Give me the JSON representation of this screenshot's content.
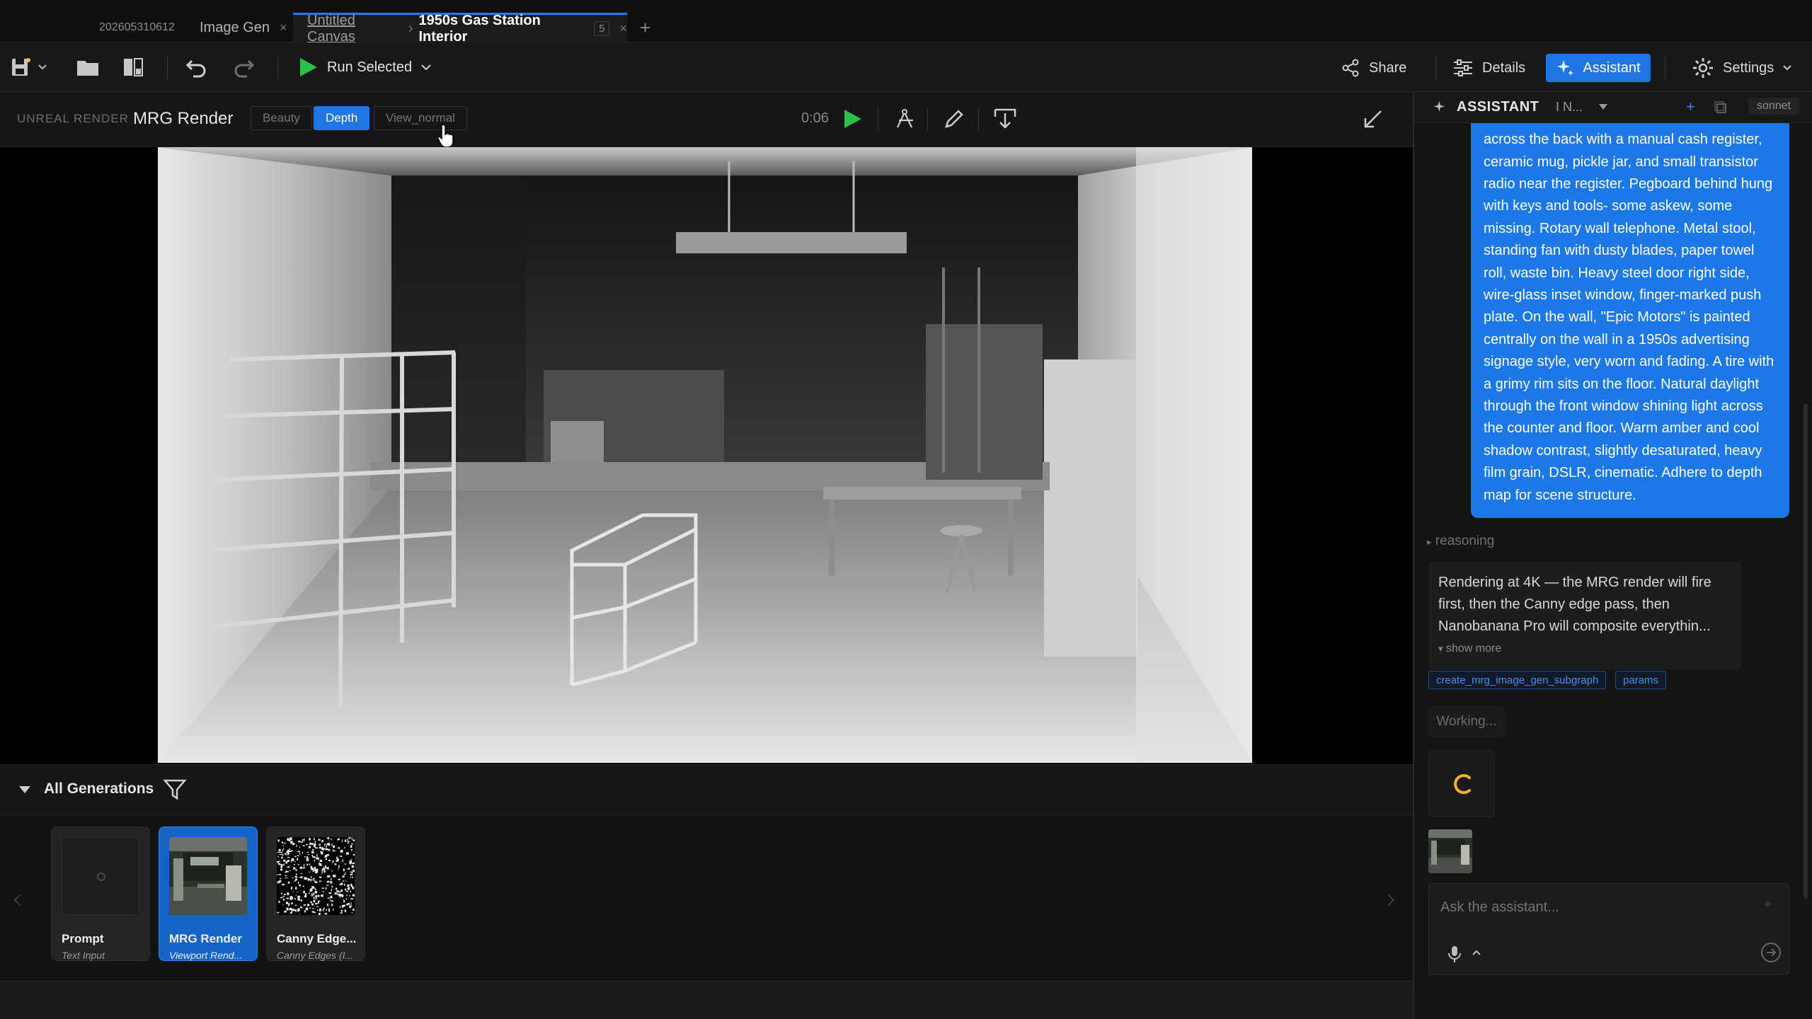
{
  "tabs": {
    "date_tab": "202605310612",
    "image_gen": "Image Gen",
    "canvas_crumb": "Untitled Canvas",
    "canvas_separator": "›",
    "canvas_title": "1950s Gas Station Interior",
    "canvas_count": "5",
    "close_glyph": "×",
    "add_glyph": "+"
  },
  "toolbar": {
    "run_selected": "Run Selected",
    "share": "Share",
    "details": "Details",
    "assistant": "Assistant",
    "settings": "Settings",
    "run_color": "#27c24c",
    "accent_color": "#1f76e3"
  },
  "render": {
    "source_label": "UNREAL RENDER",
    "title": "MRG Render",
    "passes": [
      "Beauty",
      "Depth",
      "View_normal"
    ],
    "active_pass": "Depth",
    "elapsed": "0:06"
  },
  "generations": {
    "title": "All Generations",
    "items": [
      {
        "name": "Prompt",
        "type": "Text Input"
      },
      {
        "name": "MRG Render",
        "type": "Viewport Rend..."
      },
      {
        "name": "Canny Edge...",
        "type": "Canny Edges (I..."
      }
    ],
    "selected": "MRG Render"
  },
  "assistant": {
    "title": "ASSISTANT",
    "session": "I N...",
    "model": "sonnet",
    "user_message": "across the back with a manual cash register, ceramic mug, pickle jar, and small transistor radio near the register. Pegboard behind hung with keys and tools- some askew, some missing. Rotary wall telephone. Metal stool, standing fan with dusty blades, paper towel roll, waste bin. Heavy steel door right side, wire-glass inset window, finger-marked push plate. On the wall, \"Epic Motors\" is painted centrally on the wall in a 1950s advertising signage style, very worn and fading. A tire with a grimy rim sits on the floor. Natural daylight through the front window shining light across the counter and floor. Warm amber and cool shadow contrast, slightly desaturated, heavy film grain, DSLR, cinematic. Adhere to depth map for scene structure.",
    "reasoning_label": "reasoning",
    "reasoning_text": "Rendering at 4K — the MRG render will fire first, then the Canny edge pass, then Nanobanana Pro will composite everythin...",
    "show_more": "show more",
    "tool_chips": [
      "create_mrg_image_gen_subgraph",
      "params"
    ],
    "working": "Working...",
    "input_placeholder": "Ask the assistant...",
    "spinner_color": "#f0b429"
  }
}
